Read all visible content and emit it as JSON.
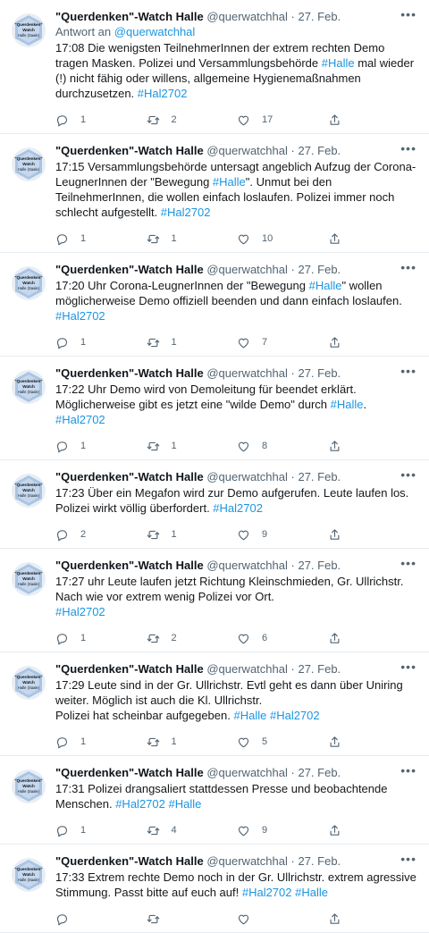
{
  "account": {
    "name": "\"Querdenken\"-Watch Halle",
    "handle": "@querwatchhal",
    "dot": "·",
    "avatar_text_lines": [
      "\"Querdenken\"",
      "Watch",
      "Halle (Saale)"
    ]
  },
  "reply_prefix": "Antwort an",
  "tweets": [
    {
      "date": "27. Feb.",
      "reply_to": "@querwatchhal",
      "segments": [
        {
          "t": "17:08 Die wenigsten TeilnehmerInnen der extrem rechten Demo tragen Masken. Polizei und Versammlungsbehörde "
        },
        {
          "t": "#Halle",
          "tag": true
        },
        {
          "t": " mal wieder (!) nicht fähig oder willens, allgemeine Hygienemaßnahmen durchzusetzen. "
        },
        {
          "t": "#Hal2702",
          "tag": true
        }
      ],
      "replies": "1",
      "retweets": "2",
      "likes": "17"
    },
    {
      "date": "27. Feb.",
      "segments": [
        {
          "t": "17:15 Versammlungsbehörde untersagt angeblich Aufzug der Corona-LeugnerInnen der \"Bewegung "
        },
        {
          "t": "#Halle",
          "tag": true
        },
        {
          "t": "\". Unmut bei den TeilnehmerInnen, die wollen einfach loslaufen. Polizei immer noch schlecht aufgestellt. "
        },
        {
          "t": "#Hal2702",
          "tag": true
        }
      ],
      "replies": "1",
      "retweets": "1",
      "likes": "10"
    },
    {
      "date": "27. Feb.",
      "segments": [
        {
          "t": "17:20 Uhr Corona-LeugnerInnen der \"Bewegung "
        },
        {
          "t": "#Halle",
          "tag": true
        },
        {
          "t": "\" wollen möglicherweise Demo offiziell beenden und dann einfach loslaufen. "
        },
        {
          "t": "#Hal2702",
          "tag": true
        }
      ],
      "replies": "1",
      "retweets": "1",
      "likes": "7"
    },
    {
      "date": "27. Feb.",
      "segments": [
        {
          "t": "17:22 Uhr Demo wird von Demoleitung für beendet erklärt. Möglicherweise gibt es jetzt eine \"wilde Demo\" durch "
        },
        {
          "t": "#Halle",
          "tag": true
        },
        {
          "t": ". "
        },
        {
          "t": "#Hal2702",
          "tag": true
        }
      ],
      "replies": "1",
      "retweets": "1",
      "likes": "8"
    },
    {
      "date": "27. Feb.",
      "segments": [
        {
          "t": "17:23 Über ein Megafon wird zur Demo aufgerufen. Leute laufen los. Polizei wirkt völlig überfordert. "
        },
        {
          "t": "#Hal2702",
          "tag": true
        }
      ],
      "replies": "2",
      "retweets": "1",
      "likes": "9"
    },
    {
      "date": "27. Feb.",
      "segments": [
        {
          "t": "17:27 uhr Leute laufen jetzt Richtung Kleinschmieden, Gr. Ullrichstr.\nNach wie vor extrem wenig Polizei vor Ort.\n"
        },
        {
          "t": "#Hal2702",
          "tag": true
        }
      ],
      "replies": "1",
      "retweets": "2",
      "likes": "6"
    },
    {
      "date": "27. Feb.",
      "segments": [
        {
          "t": "17:29 Leute sind in der Gr. Ullrichstr. Evtl geht es dann über Uniring weiter. Möglich ist auch die Kl. Ullrichstr.\nPolizei hat scheinbar aufgegeben. "
        },
        {
          "t": "#Halle",
          "tag": true
        },
        {
          "t": " "
        },
        {
          "t": "#Hal2702",
          "tag": true
        }
      ],
      "replies": "1",
      "retweets": "1",
      "likes": "5"
    },
    {
      "date": "27. Feb.",
      "segments": [
        {
          "t": "17:31 Polizei drangsaliert stattdessen Presse und beobachtende Menschen. "
        },
        {
          "t": "#Hal2702",
          "tag": true
        },
        {
          "t": " "
        },
        {
          "t": "#Halle",
          "tag": true
        }
      ],
      "replies": "1",
      "retweets": "4",
      "likes": "9"
    },
    {
      "date": "27. Feb.",
      "segments": [
        {
          "t": "17:33 Extrem rechte Demo noch in der Gr. Ullrichstr. extrem agressive Stimmung. Passt bitte auf euch auf! "
        },
        {
          "t": "#Hal2702",
          "tag": true
        },
        {
          "t": " "
        },
        {
          "t": "#Halle",
          "tag": true
        }
      ],
      "replies": "",
      "retweets": "",
      "likes": ""
    }
  ],
  "icons": {
    "reply": "reply-icon",
    "retweet": "retweet-icon",
    "like": "like-icon",
    "share": "share-icon",
    "more": "more-icon"
  },
  "colors": {
    "link": "#1b95e0",
    "secondary": "#536471",
    "divider": "#e6ecf0"
  }
}
